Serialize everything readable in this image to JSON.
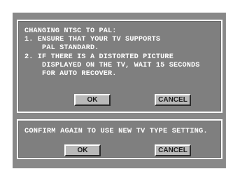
{
  "dialog_top": {
    "message": "CHANGING NTSC TO PAL:\n1. ENSURE THAT YOUR TV SUPPORTS\n    PAL STANDARD.\n2. IF THERE IS A DISTORTED PICTURE\n    DISPLAYED ON THE TV, WAIT 15 SECONDS\n    FOR AUTO RECOVER.",
    "ok_label": "OK",
    "cancel_label": "CANCEL"
  },
  "dialog_bottom": {
    "message": "CONFIRM AGAIN TO USE NEW TV TYPE SETTING.",
    "ok_label": "OK",
    "cancel_label": "CANCEL"
  },
  "colors": {
    "screen_bg": "#888888",
    "dialog_bg": "#7f7f7f",
    "dialog_border": "#ffffff",
    "text": "#ffffff",
    "button_bg": "#b9b9b9"
  }
}
